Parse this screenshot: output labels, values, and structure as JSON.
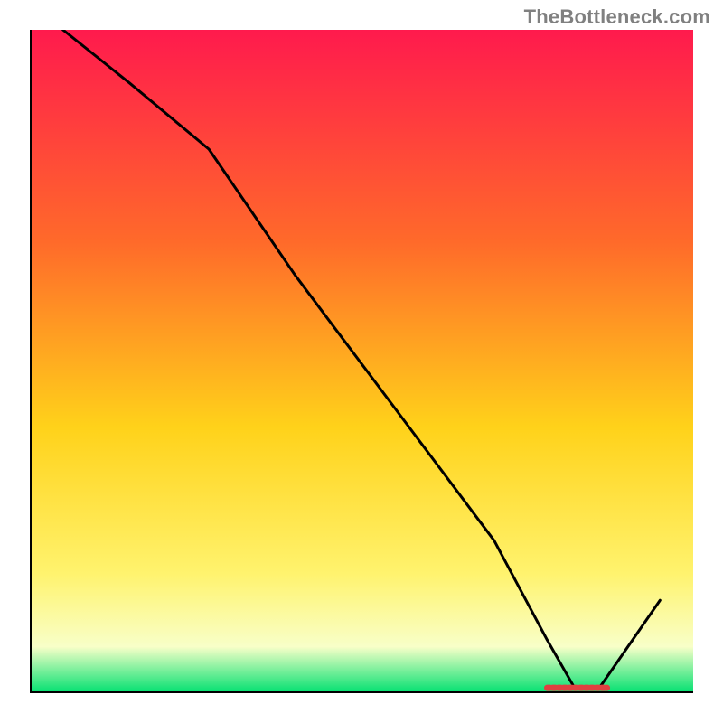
{
  "brand": {
    "watermark": "TheBottleneck.com"
  },
  "colors": {
    "gradient_top": "#ff1a4d",
    "gradient_mid1": "#ff6a2a",
    "gradient_mid2": "#ffd21a",
    "gradient_mid3": "#fff36e",
    "gradient_mid4": "#f8ffc8",
    "gradient_bottom": "#00e070",
    "axis": "#000000",
    "line": "#000000",
    "marker": "#e04040"
  },
  "chart_data": {
    "type": "line",
    "title": "",
    "xlabel": "",
    "ylabel": "",
    "xlim": [
      0,
      100
    ],
    "ylim": [
      0,
      100
    ],
    "grid": false,
    "legend": false,
    "series": [
      {
        "name": "curve",
        "x": [
          5,
          15,
          27,
          40,
          55,
          70,
          78,
          82,
          86,
          95
        ],
        "values": [
          100,
          92,
          82,
          63,
          43,
          23,
          8,
          1,
          1,
          14
        ]
      }
    ],
    "annotations": [
      {
        "name": "flat-minimum-marker",
        "x_from": 78,
        "x_to": 87,
        "y": 0.8
      }
    ]
  }
}
